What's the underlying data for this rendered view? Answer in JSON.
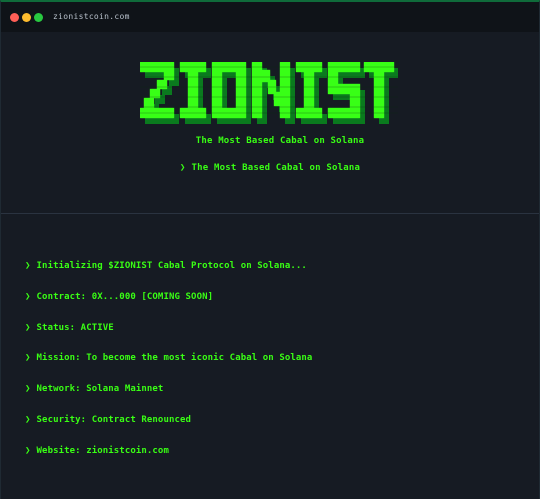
{
  "browser": {
    "url": "zionistcoin.com"
  },
  "hero": {
    "logo_text": "ZIONIST",
    "tagline": "The Most Based Cabal on Solana",
    "prompt_symbol": "❯",
    "prompt_tagline": "The Most Based Cabal on Solana"
  },
  "terminal": {
    "prompt_symbol": "❯",
    "lines": [
      "Initializing $ZIONIST Cabal Protocol on Solana...",
      "Contract: 0X...000 [COMING SOON]",
      "Status: ACTIVE",
      "Mission: To become the most iconic Cabal on Solana",
      "Network: Solana Mainnet",
      "Security: Contract Renounced",
      "Website: zionistcoin.com"
    ]
  },
  "colors": {
    "accent": "#39ff14",
    "background": "#161b23",
    "titlebar": "#0f1318"
  }
}
